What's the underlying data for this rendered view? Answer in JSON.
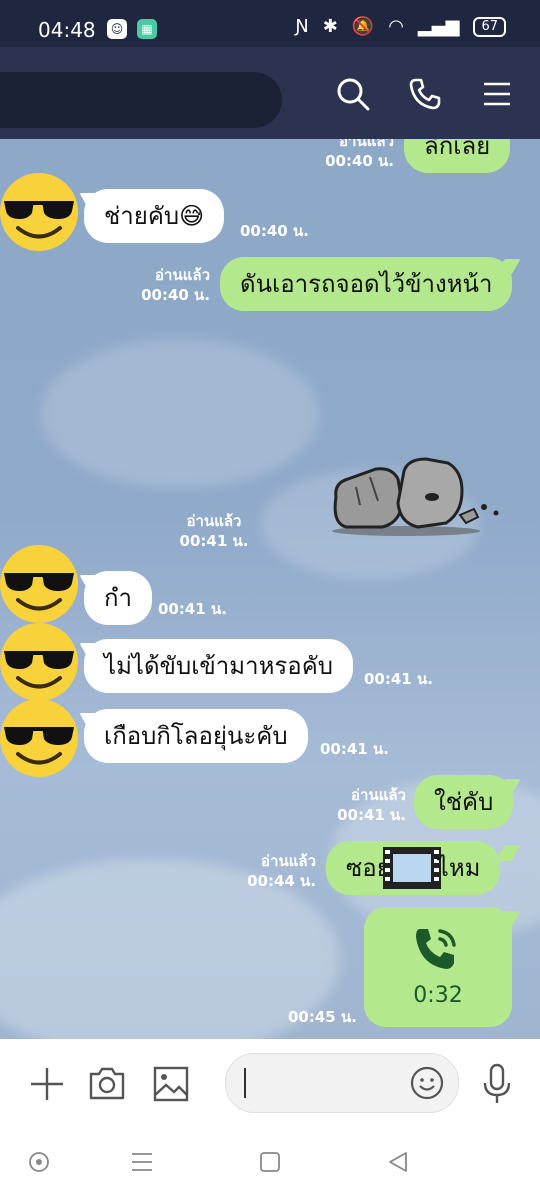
{
  "status_bar": {
    "time": "04:48",
    "battery": "67"
  },
  "messages": [
    {
      "id": "m0",
      "dir": "out",
      "text": "ลึกเลย",
      "read": "อ่านแล้ว",
      "time": "00:40 น."
    },
    {
      "id": "m1",
      "dir": "in",
      "text": "ช่ายคับ😅",
      "time": "00:40 น."
    },
    {
      "id": "m2",
      "dir": "out",
      "text": "ดันเอารถจอดไว้ข้างหน้า",
      "read": "อ่านแล้ว",
      "time": "00:40 น."
    },
    {
      "id": "m3",
      "dir": "out",
      "type": "sticker",
      "sticker": "rock-creature-sticker",
      "read": "อ่านแล้ว",
      "time": "00:41 น."
    },
    {
      "id": "m4",
      "dir": "in",
      "text": "กำ",
      "time": "00:41 น."
    },
    {
      "id": "m5",
      "dir": "in",
      "text": "ไม่ได้ขับเข้ามาหรอคับ",
      "time": "00:41 น."
    },
    {
      "id": "m6",
      "dir": "in",
      "text": "เกือบกิโลอยุ่นะคับ",
      "time": "00:41 น."
    },
    {
      "id": "m7",
      "dir": "out",
      "text": "ใช่คับ",
      "read": "อ่านแล้ว",
      "time": "00:41 น."
    },
    {
      "id": "m8",
      "dir": "out",
      "text_before": "ซอย",
      "text_after": "ไหม",
      "emoji": "film-frames-emoji",
      "read": "อ่านแล้ว",
      "time": "00:44 น."
    },
    {
      "id": "m9",
      "dir": "out",
      "type": "call",
      "duration": "0:32",
      "time": "00:45 น."
    }
  ],
  "input": {
    "placeholder": ""
  },
  "colors": {
    "header": "#2b3350",
    "outgoing": "#b4e88c",
    "incoming": "#ffffff",
    "chat_bg": "#8ea6c6"
  }
}
